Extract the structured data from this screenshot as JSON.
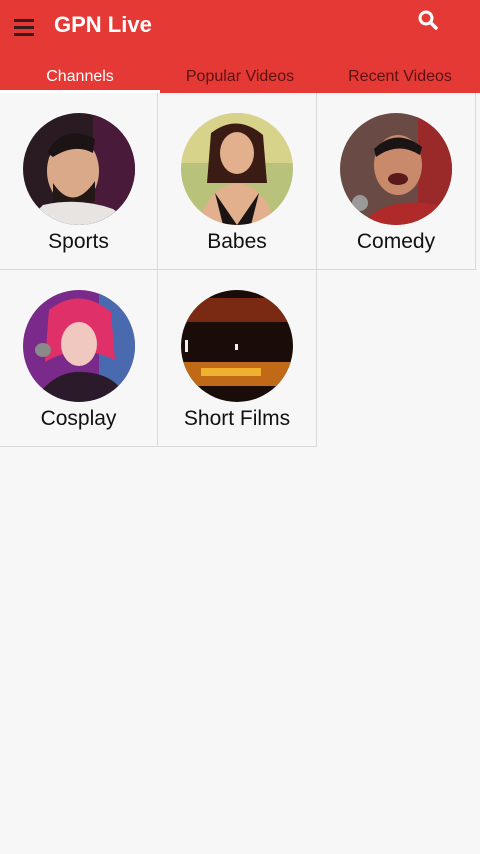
{
  "app": {
    "title": "GPN Live",
    "accent_color": "#e53935"
  },
  "icons": {
    "menu": "menu-icon",
    "search": "search-icon"
  },
  "tabs": [
    {
      "label": "Channels",
      "active": true
    },
    {
      "label": "Popular Videos",
      "active": false
    },
    {
      "label": "Recent Videos",
      "active": false
    }
  ],
  "channels": [
    {
      "label": "Sports",
      "image": "bearded-man-portrait"
    },
    {
      "label": "Babes",
      "image": "woman-portrait"
    },
    {
      "label": "Comedy",
      "image": "man-with-microphone"
    },
    {
      "label": "Cosplay",
      "image": "pink-hair-singer"
    },
    {
      "label": "Short Films",
      "image": "dark-film-scene"
    }
  ]
}
